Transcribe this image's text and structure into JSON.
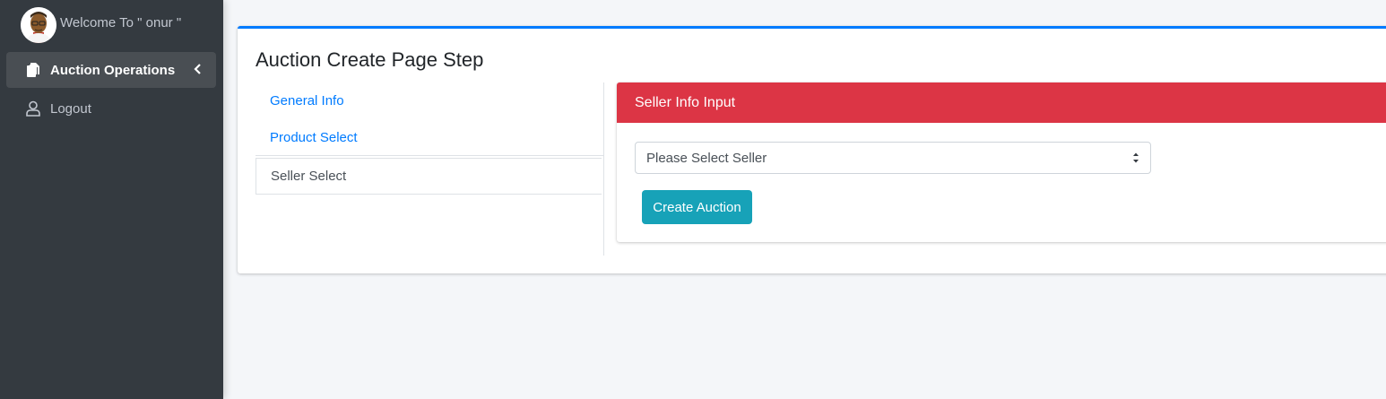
{
  "sidebar": {
    "welcome_text": "Welcome To \" onur \"",
    "avatar_icon": "user-avatar-icon",
    "items": [
      {
        "label": "Auction Operations",
        "icon": "copy-icon",
        "active": true,
        "has_submenu": true
      },
      {
        "label": "Logout",
        "icon": "user-icon",
        "active": false,
        "has_submenu": false
      }
    ]
  },
  "main": {
    "title": "Auction Create Page Step",
    "steps": [
      {
        "label": "General Info",
        "active": false
      },
      {
        "label": "Product Select",
        "active": false
      },
      {
        "label": "Seller Select",
        "active": true
      }
    ],
    "panel": {
      "header": "Seller Info Input",
      "select_value": "Please Select Seller",
      "button_label": "Create Auction"
    }
  },
  "colors": {
    "sidebar_bg": "#343a40",
    "accent_blue": "#007bff",
    "danger_red": "#dc3545",
    "info_teal": "#17a2b8"
  }
}
